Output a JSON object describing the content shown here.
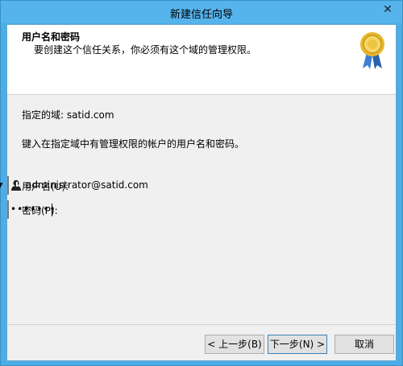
{
  "window": {
    "title": "新建信任向导",
    "close_glyph": "✕"
  },
  "header": {
    "title": "用户名和密码",
    "subtitle": "要创建这个信任关系，你必须有这个域的管理权限。"
  },
  "body": {
    "domain_line": "指定的域: satid.com",
    "instruction": "键入在指定域中有管理权限的帐户的用户名和密码。",
    "username_label": "用户名(U):",
    "username_value": "administrator@satid.com",
    "password_label": "密码(P):",
    "password_value": "•••••••"
  },
  "buttons": {
    "back": "< 上一步(B)",
    "next": "下一步(N) >",
    "cancel": "取消"
  },
  "icons": {
    "medal": "certificate-medal-icon",
    "user": "user-icon",
    "dropdown": "chevron-down-icon"
  }
}
